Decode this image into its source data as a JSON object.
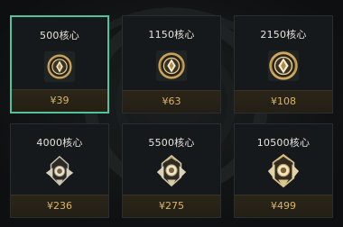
{
  "store": {
    "items": [
      {
        "title": "500核心",
        "price": "¥39",
        "icon": "essence-orb-icon-small",
        "selected": true
      },
      {
        "title": "1150核心",
        "price": "¥63",
        "icon": "essence-orb-icon-medium",
        "selected": false
      },
      {
        "title": "2150核心",
        "price": "¥108",
        "icon": "essence-orb-icon-large",
        "selected": false
      },
      {
        "title": "4000核心",
        "price": "¥236",
        "icon": "essence-crystal-icon-small",
        "selected": false
      },
      {
        "title": "5500核心",
        "price": "¥275",
        "icon": "essence-crystal-icon-medium",
        "selected": false
      },
      {
        "title": "10500核心",
        "price": "¥499",
        "icon": "essence-crystal-icon-large",
        "selected": false
      }
    ],
    "colors": {
      "selected_border": "#4fc39c",
      "price_text": "#d9b56a",
      "title_text": "#e8e4dc"
    }
  }
}
